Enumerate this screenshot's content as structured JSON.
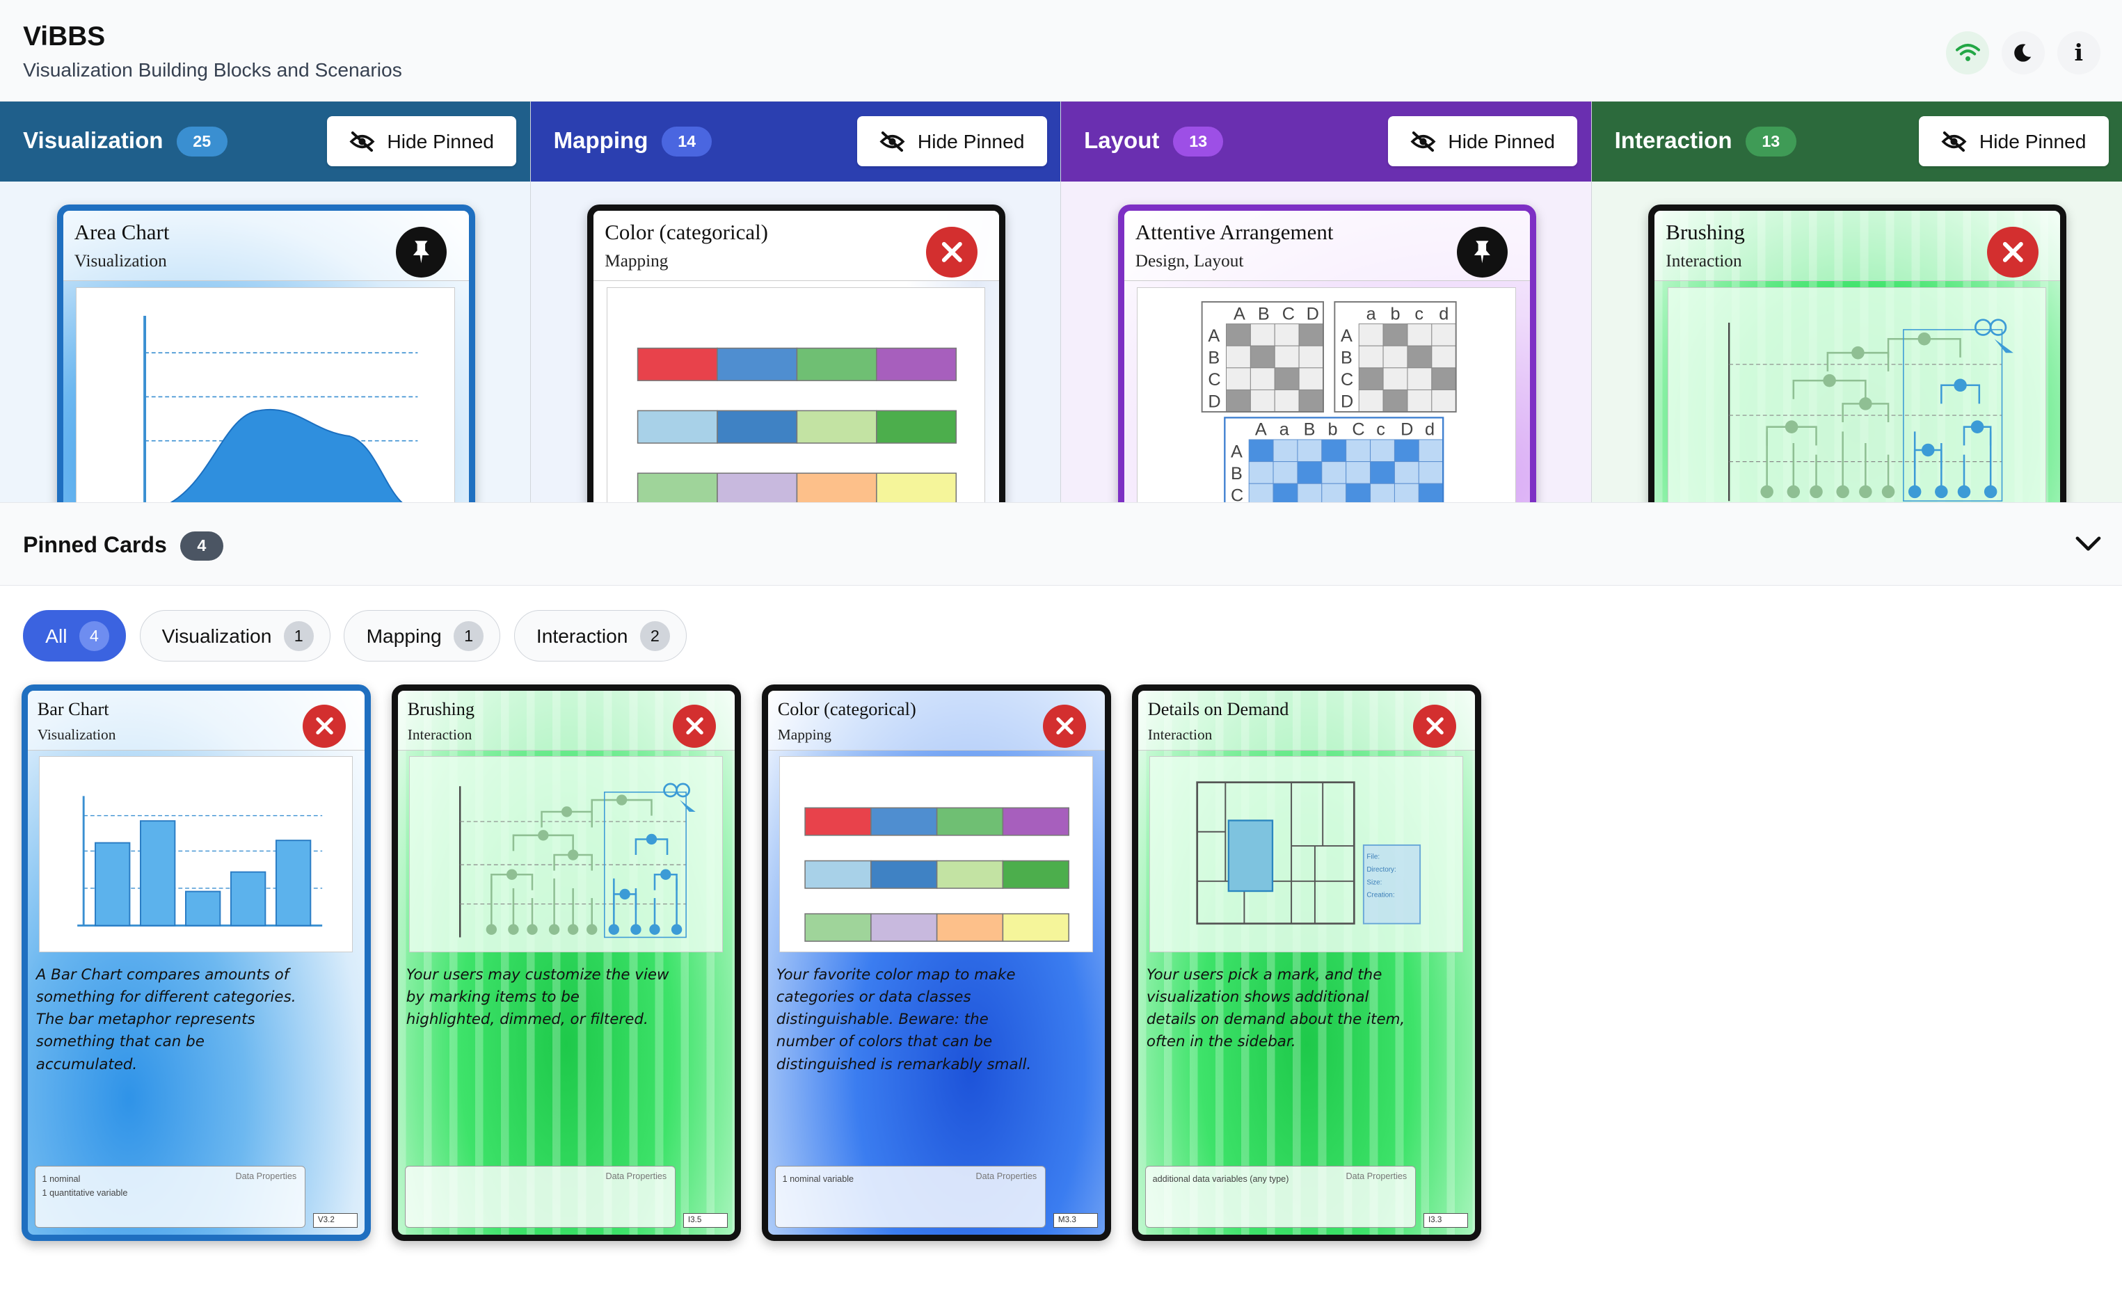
{
  "app": {
    "title": "ViBBS",
    "subtitle": "Visualization Building Blocks and Scenarios"
  },
  "header_icons": [
    "wifi-icon",
    "moon-icon",
    "info-icon"
  ],
  "columns": [
    {
      "title": "Visualization",
      "count": "25",
      "color": "#1f5f8b",
      "badge_color": "#3a8fd1",
      "hide_label": "Hide Pinned",
      "card": {
        "title": "Area Chart",
        "subtitle": "Visualization",
        "action": "pin",
        "theme": "blue"
      }
    },
    {
      "title": "Mapping",
      "count": "14",
      "color": "#2b3fb0",
      "badge_color": "#4a66e0",
      "hide_label": "Hide Pinned",
      "card": {
        "title": "Color (categorical)",
        "subtitle": "Mapping",
        "action": "close",
        "theme": "white"
      }
    },
    {
      "title": "Layout",
      "count": "13",
      "color": "#6a2fb0",
      "badge_color": "#9d4fe6",
      "hide_label": "Hide Pinned",
      "card": {
        "title": "Attentive Arrangement",
        "subtitle": "Design, Layout",
        "action": "pin",
        "theme": "purple"
      }
    },
    {
      "title": "Interaction",
      "count": "13",
      "color": "#2c6a3c",
      "badge_color": "#3f9b56",
      "hide_label": "Hide Pinned",
      "card": {
        "title": "Brushing",
        "subtitle": "Interaction",
        "action": "close",
        "theme": "green"
      }
    }
  ],
  "pinned": {
    "title": "Pinned Cards",
    "count": "4",
    "filters": [
      {
        "label": "All",
        "count": "4",
        "active": true
      },
      {
        "label": "Visualization",
        "count": "1",
        "active": false
      },
      {
        "label": "Mapping",
        "count": "1",
        "active": false
      },
      {
        "label": "Interaction",
        "count": "2",
        "active": false
      }
    ],
    "cards": [
      {
        "title": "Bar Chart",
        "subtitle": "Visualization",
        "theme": "blue",
        "description": "A Bar Chart compares amounts of something for different categories. The bar metaphor represents something that can be accumulated.",
        "props_label": "Data Properties",
        "props": [
          "1 nominal",
          "1 quantitative variable"
        ],
        "version": "V3.2"
      },
      {
        "title": "Brushing",
        "subtitle": "Interaction",
        "theme": "green",
        "description": "Your users may customize the view by marking items to be highlighted, dimmed, or filtered.",
        "props_label": "Data Properties",
        "props": [],
        "version": "I3.5"
      },
      {
        "title": "Color (categorical)",
        "subtitle": "Mapping",
        "theme": "navy",
        "description": "Your favorite color map to make categories or data classes distinguishable. Beware: the number of colors that can be distinguished is remarkably small.",
        "props_label": "Data Properties",
        "props": [
          "1 nominal variable"
        ],
        "version": "M3.3"
      },
      {
        "title": "Details on Demand",
        "subtitle": "Interaction",
        "theme": "green",
        "description": "Your users pick a mark, and the visualization shows additional details on demand about the item, often in the sidebar.",
        "props_label": "Data Properties",
        "props": [
          "additional data variables (any type)"
        ],
        "version": "I3.3",
        "detail_labels": [
          "File:",
          "Directory:",
          "Size:",
          "Creation:"
        ]
      }
    ]
  },
  "palette": {
    "categorical_rows": [
      [
        "#e8424b",
        "#4f8ed0",
        "#6fbf73",
        "#a75fbd"
      ],
      [
        "#a8d1e8",
        "#3f82c4",
        "#c3e3a3",
        "#4cae4c"
      ],
      [
        "#9fd49a",
        "#c8b9de",
        "#fdc08a",
        "#f5f59a"
      ]
    ],
    "layout_grid_cols": [
      "A",
      "B",
      "C",
      "D"
    ],
    "layout_grid_cols_lower": [
      "a",
      "b",
      "c",
      "d"
    ],
    "layout_merged_cols": [
      "A",
      "a",
      "B",
      "b",
      "C",
      "c",
      "D",
      "d"
    ]
  }
}
